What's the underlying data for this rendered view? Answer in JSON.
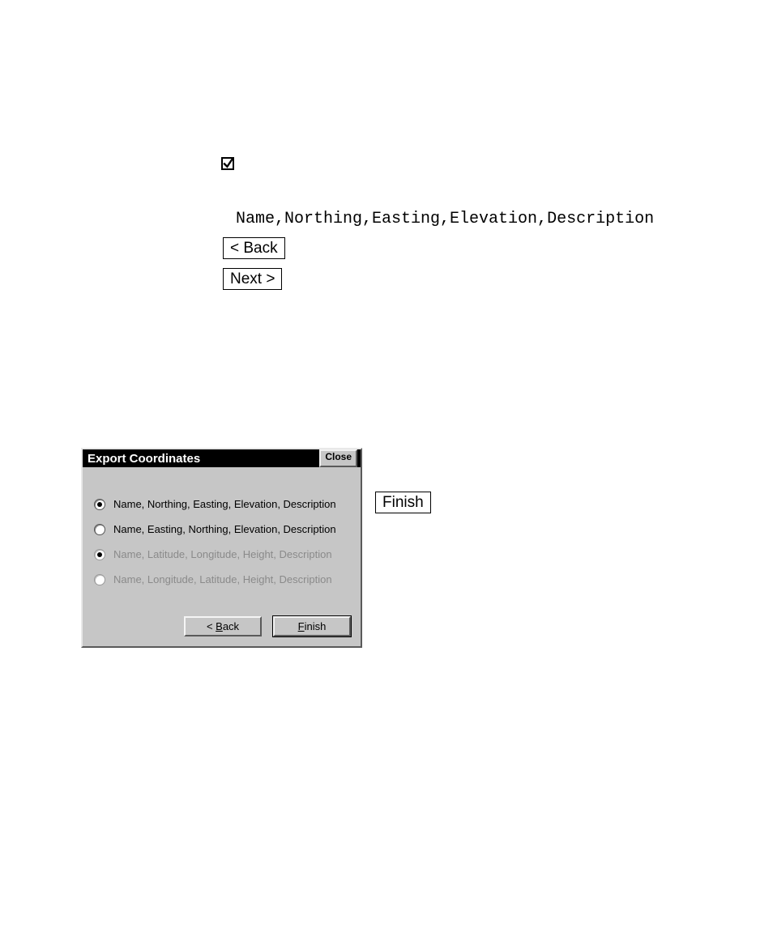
{
  "checkbox": {
    "checked": true
  },
  "sample_header": "Name,Northing,Easting,Elevation,Description",
  "inline": {
    "back_label": "< Back",
    "next_label": "Next >",
    "finish_label": "Finish"
  },
  "dialog": {
    "title": "Export Coordinates",
    "close_label": "Close",
    "options": [
      {
        "label": "Name, Northing, Easting, Elevation, Description",
        "selected": true,
        "enabled": true
      },
      {
        "label": "Name, Easting, Northing, Elevation, Description",
        "selected": false,
        "enabled": true
      },
      {
        "label": "Name, Latitude, Longitude, Height, Description",
        "selected": true,
        "enabled": false
      },
      {
        "label": "Name, Longitude, Latitude, Height, Description",
        "selected": false,
        "enabled": false
      }
    ],
    "back_mnemonic": "B",
    "back_rest": "ack",
    "back_prefix": "< ",
    "finish_mnemonic": "F",
    "finish_rest": "inish"
  }
}
